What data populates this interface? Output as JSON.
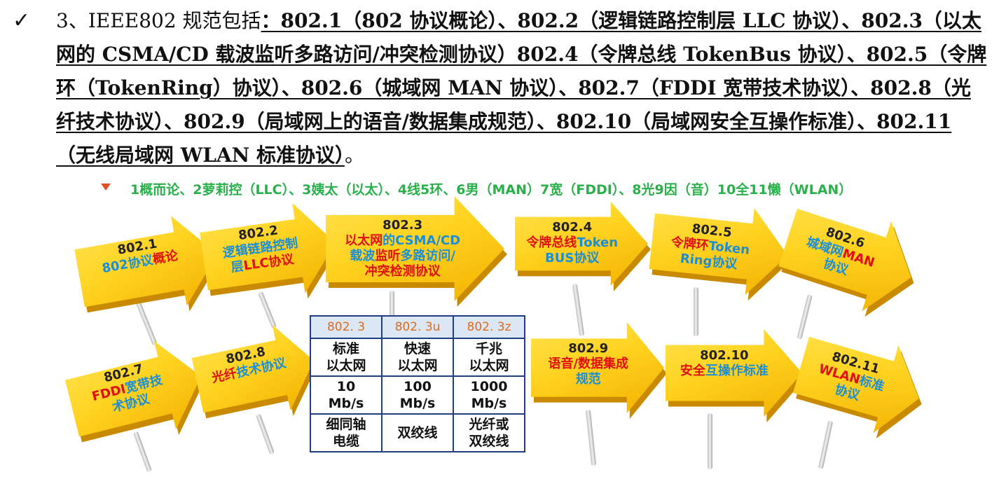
{
  "paragraph": {
    "checkmark": "✓",
    "lead": "3、IEEE802 规范包括",
    "body": "：802.1（802 协议概论）、802.2（逻辑链路控制层 LLC 协议）、802.3（以太网的 CSMA/CD 载波监听多路访问/冲突检测协议）802.4（令牌总线 TokenBus 协议）、802.5（令牌环（TokenRing）协议）、802.6（城域网 MAN 协议）、802.7（FDDI 宽带技术协议）、802.8（光纤技术协议）、802.9（局域网上的语音/数据集成规范）、802.10（局域网安全互操作标准）、802.11（无线局域网 WLAN 标准协议）",
    "end": "。"
  },
  "mnemonic": "1概而论、2萝莉控（LLC）、3姨太（以太）、4线5环、6男（MAN）7宽（FDDI）、8光9因（音）10全11懒（WLAN）",
  "signs": [
    {
      "num": "802.1",
      "parts": [
        [
          "802协议",
          "b"
        ],
        [
          "概论",
          "r"
        ]
      ]
    },
    {
      "num": "802.2",
      "parts": [
        [
          "逻辑链路控制",
          "b"
        ],
        [
          "\n层",
          "b"
        ],
        [
          "LLC协议",
          "r"
        ]
      ]
    },
    {
      "num": "802.3",
      "parts": [
        [
          "以太网",
          "r"
        ],
        [
          "的CSMA/CD",
          "b"
        ],
        [
          "\n载波",
          "b"
        ],
        [
          "监听",
          "r"
        ],
        [
          "多路访问/",
          "b"
        ],
        [
          "\n冲突检测协议",
          "r"
        ]
      ]
    },
    {
      "num": "802.4",
      "parts": [
        [
          "令牌总线",
          "r"
        ],
        [
          "Token",
          "b"
        ],
        [
          "\nBUS协议",
          "b"
        ]
      ]
    },
    {
      "num": "802.5",
      "parts": [
        [
          "令牌环",
          "r"
        ],
        [
          "Token",
          "b"
        ],
        [
          "\nRing协议",
          "b"
        ]
      ]
    },
    {
      "num": "802.6",
      "parts": [
        [
          "城域网",
          "b"
        ],
        [
          "MAN",
          "r"
        ],
        [
          "\n协议",
          "b"
        ]
      ]
    },
    {
      "num": "802.7",
      "parts": [
        [
          "FDDI",
          "r"
        ],
        [
          "宽带技",
          "b"
        ],
        [
          "\n术协议",
          "b"
        ]
      ]
    },
    {
      "num": "802.8",
      "parts": [
        [
          "光纤",
          "r"
        ],
        [
          "技术协议",
          "b"
        ]
      ]
    },
    {
      "num": "802.9",
      "parts": [
        [
          "语音/数据集成",
          "r"
        ],
        [
          "\n规范",
          "b"
        ]
      ]
    },
    {
      "num": "802.10",
      "parts": [
        [
          "安全",
          "r"
        ],
        [
          "互操作标准",
          "b"
        ]
      ]
    },
    {
      "num": "802.11",
      "parts": [
        [
          "WLAN",
          "r"
        ],
        [
          "标准",
          "b"
        ],
        [
          "\n协议",
          "b"
        ]
      ]
    }
  ],
  "table": {
    "headers": [
      "802. 3",
      "802. 3u",
      "802. 3z"
    ],
    "rows": [
      [
        "标准\n以太网",
        "快速\n以太网",
        "千兆\n以太网"
      ],
      [
        "10\nMb/s",
        "100\nMb/s",
        "1000\nMb/s"
      ],
      [
        "细同轴\n电缆",
        "双绞线",
        "光纤或\n双绞线"
      ]
    ]
  }
}
